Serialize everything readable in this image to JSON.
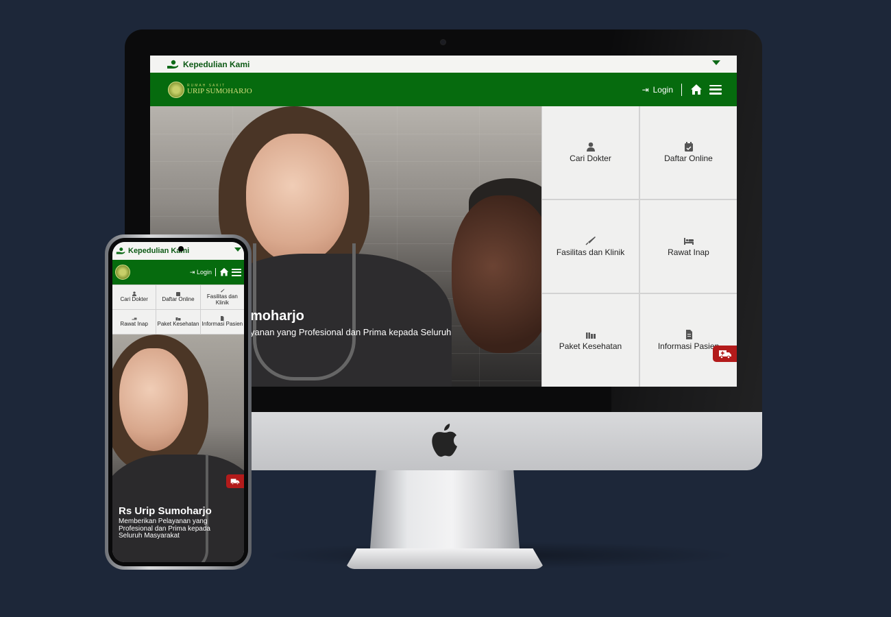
{
  "colors": {
    "background": "#1d2739",
    "brand_green": "#066b0e",
    "text_green": "#0e5a16",
    "emergency_red": "#b31b1b",
    "tile_bg": "#f0f0ef"
  },
  "desktop": {
    "topbar": {
      "label": "Kepedulian Kami",
      "icon": "hand-heart-icon"
    },
    "navbar": {
      "logo_small": "RUMAH SAKIT",
      "logo_text": "URIP SUMOHARJO",
      "login_label": "Login",
      "icons": [
        "login-arrow-icon",
        "home-icon",
        "menu-icon"
      ]
    },
    "hero": {
      "title": "moharjo",
      "subtitle": "yanan yang Profesional dan Prima kepada Seluruh"
    },
    "tiles": [
      {
        "label": "Cari Dokter",
        "icon": "doctor-icon"
      },
      {
        "label": "Daftar Online",
        "icon": "calendar-check-icon"
      },
      {
        "label": "Fasilitas dan Klinik",
        "icon": "syringe-icon"
      },
      {
        "label": "Rawat Inap",
        "icon": "bed-icon"
      },
      {
        "label": "Paket Kesehatan",
        "icon": "gifts-icon"
      },
      {
        "label": "Informasi Pasien",
        "icon": "file-icon"
      }
    ],
    "emergency_icon": "ambulance-icon"
  },
  "mobile": {
    "topbar": {
      "label": "Kepedulian Kami"
    },
    "navbar": {
      "login_label": "Login"
    },
    "tiles": [
      {
        "label": "Cari Dokter"
      },
      {
        "label": "Daftar Online"
      },
      {
        "label": "Fasilitas dan Klinik"
      },
      {
        "label": "Rawat Inap"
      },
      {
        "label": "Paket Kesehatan"
      },
      {
        "label": "Informasi Pasien"
      }
    ],
    "hero": {
      "title": "Rs Urip Sumoharjo",
      "subtitle": "Memberikan Pelayanan yang Profesional dan Prima kepada Seluruh Masyarakat"
    }
  }
}
